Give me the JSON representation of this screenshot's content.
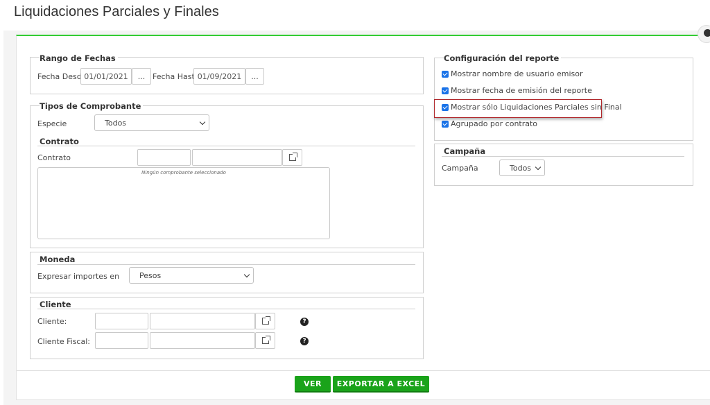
{
  "page": {
    "title": "Liquidaciones Parciales y Finales"
  },
  "rango_fechas": {
    "legend": "Rango de Fechas",
    "desde_label": "Fecha Desde",
    "desde_value": "01/01/2021",
    "hasta_label": "Fecha Hasta",
    "hasta_value": "01/09/2021",
    "picker_label": "..."
  },
  "tipos_comprobante": {
    "legend": "Tipos de Comprobante",
    "especie_label": "Especie",
    "especie_value": "Todos",
    "contrato_legend": "Contrato",
    "contrato_label": "Contrato",
    "empty_message": "Ningún comprobante seleccionado"
  },
  "moneda": {
    "legend": "Moneda",
    "expresar_label": "Expresar importes en",
    "expresar_value": "Pesos"
  },
  "cliente": {
    "legend": "Cliente",
    "cliente_label": "Cliente:",
    "cliente_fiscal_label": "Cliente Fiscal:",
    "help_glyph": "?"
  },
  "configuracion": {
    "legend": "Configuración del reporte",
    "options": [
      {
        "label": "Mostrar nombre de usuario emisor",
        "checked": true
      },
      {
        "label": "Mostrar fecha de emisión del reporte",
        "checked": true
      },
      {
        "label": "Mostrar sólo Liquidaciones Parciales sin Final",
        "checked": true
      },
      {
        "label": "Agrupado por contrato",
        "checked": true
      }
    ]
  },
  "campana": {
    "legend": "Campaña",
    "label": "Campaña",
    "value": "Todos"
  },
  "actions": {
    "ver_label": "VER",
    "exportar_label": "EXPORTAR A EXCEL"
  },
  "colors": {
    "accent": "#33cc33",
    "button": "#1aa31a",
    "highlight": "#b0282c",
    "checkbox": "#1a73e8"
  },
  "icons": [
    "external-link-icon",
    "help-icon",
    "user-icon",
    "chevron-down-icon",
    "checkbox-checked-icon"
  ]
}
